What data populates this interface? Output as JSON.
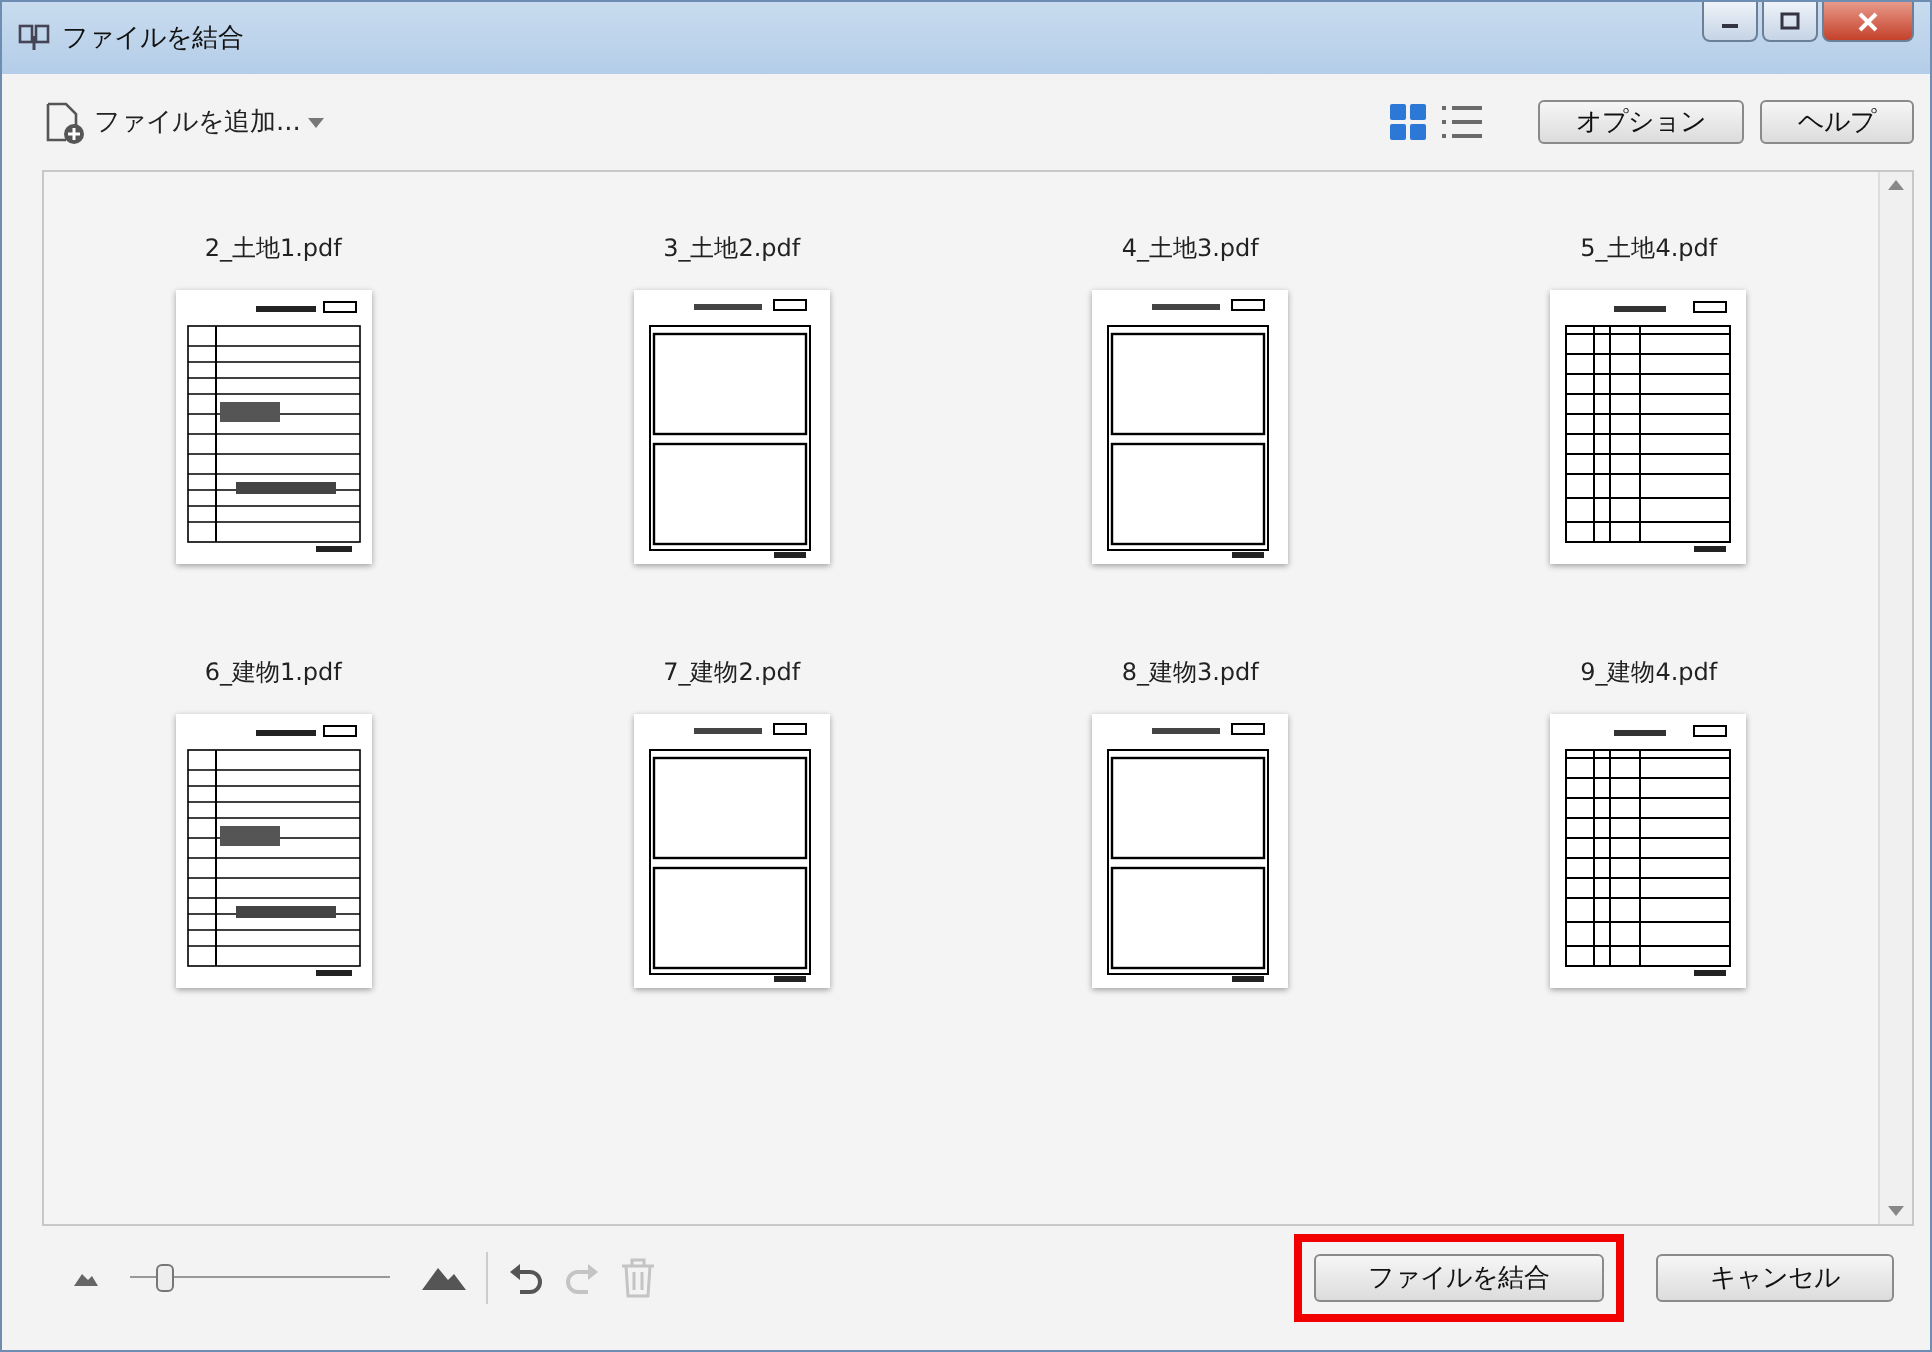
{
  "window": {
    "title": "ファイルを結合"
  },
  "toolbar": {
    "add_files": "ファイルを追加...",
    "view_modes": [
      {
        "kind": "grid",
        "selected": true
      },
      {
        "kind": "list",
        "selected": false
      }
    ],
    "buttons": [
      "オプション",
      "ヘルプ"
    ]
  },
  "files": [
    {
      "name": "2_土地1.pdf",
      "kind": "form"
    },
    {
      "name": "3_土地2.pdf",
      "kind": "photo"
    },
    {
      "name": "4_土地3.pdf",
      "kind": "photo"
    },
    {
      "name": "5_土地4.pdf",
      "kind": "table"
    },
    {
      "name": "6_建物1.pdf",
      "kind": "form"
    },
    {
      "name": "7_建物2.pdf",
      "kind": "photo"
    },
    {
      "name": "8_建物3.pdf",
      "kind": "photo"
    },
    {
      "name": "9_建物4.pdf",
      "kind": "table"
    }
  ],
  "bottom": {
    "zoom": {
      "level": 0.12
    },
    "undo": {
      "disabled": false
    },
    "redo": {
      "disabled": true
    },
    "delete": {
      "disabled": true
    },
    "buttons": [
      {
        "label": "ファイルを結合",
        "highlighted": true
      },
      {
        "label": "キャンセル",
        "highlighted": false
      }
    ]
  }
}
